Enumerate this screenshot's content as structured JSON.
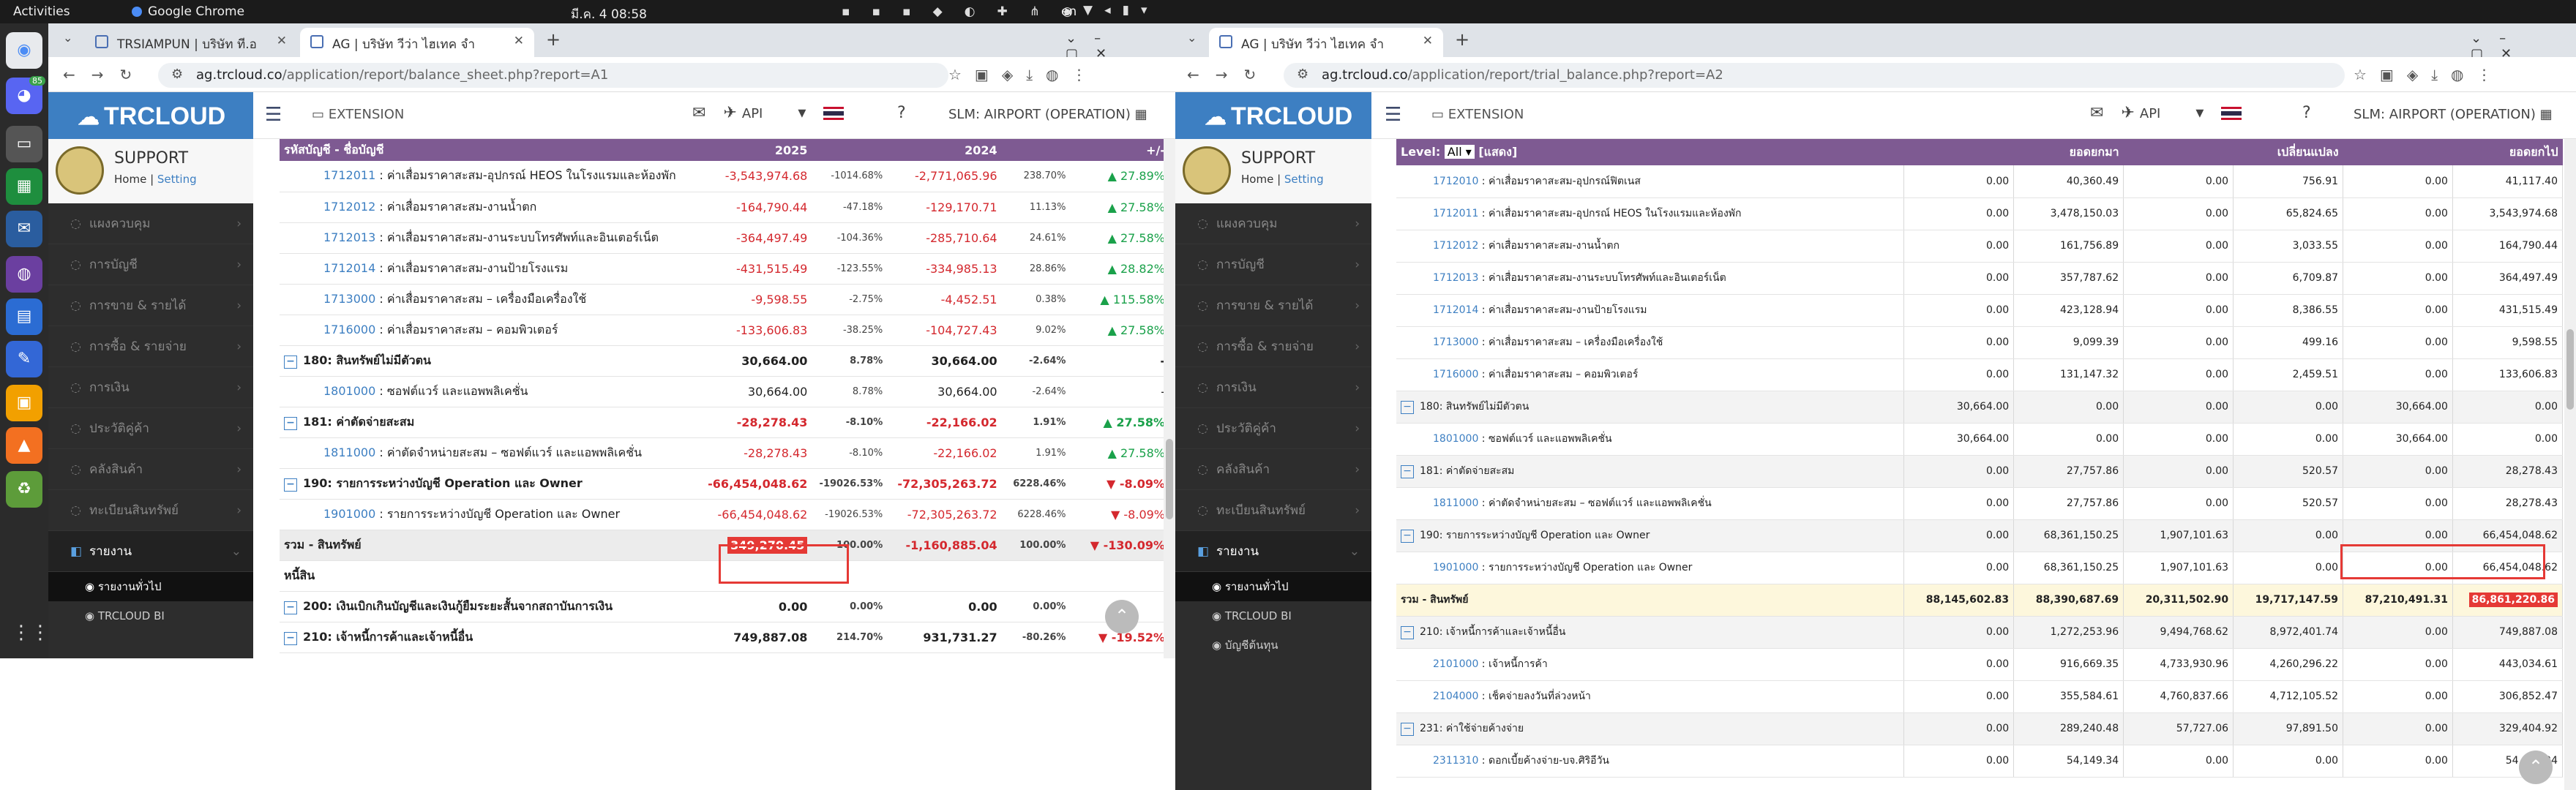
{
  "os": {
    "activities": "Activities",
    "app_name": "Google Chrome",
    "clock": "มี.ค. 4  08:58",
    "lang": "en"
  },
  "dock_badge": "85",
  "left_window": {
    "tabs": [
      {
        "title": "TRSIAMPUN | บริษัท ที.อ"
      },
      {
        "title": "AG | บริษัท วีว่า ไฮเทค จำ"
      }
    ],
    "url_host": "ag.trcloud.co",
    "url_path": "/application/report/balance_sheet.php?report=A1",
    "header": {
      "extension": "EXTENSION",
      "api": "API",
      "slm": "SLM: AIRPORT (OPERATION)"
    },
    "user": {
      "name": "SUPPORT",
      "home": "Home",
      "setting": "Setting"
    },
    "menu": [
      {
        "label": "แผงควบคุม",
        "icon": "dashboard-icon"
      },
      {
        "label": "การบัญชี",
        "icon": "accounting-icon"
      },
      {
        "label": "การขาย & รายได้",
        "icon": "sales-icon"
      },
      {
        "label": "การซื้อ & รายจ่าย",
        "icon": "purchase-icon"
      },
      {
        "label": "การเงิน",
        "icon": "finance-icon"
      },
      {
        "label": "ประวัติคู่ค้า",
        "icon": "contacts-icon"
      },
      {
        "label": "คลังสินค้า",
        "icon": "warehouse-icon"
      },
      {
        "label": "ทะเบียนสินทรัพย์",
        "icon": "asset-icon"
      },
      {
        "label": "รายงาน",
        "icon": "report-icon"
      }
    ],
    "submenu": [
      {
        "label": "รายงานทั่วไป"
      },
      {
        "label": "TRCLOUD BI"
      }
    ],
    "table_head": {
      "name": "รหัสบัญชี - ชื่อบัญชี",
      "y1": "2025",
      "y2": "2024",
      "chg": "+/-"
    },
    "rows": [
      {
        "code": "1712011",
        "name": "ค่าเสื่อมราคาสะสม-อุปกรณ์ HEOS ในโรงแรมและห้องพัก",
        "v1": "-3,543,974.68",
        "p1": "-1014.68%",
        "v2": "-2,771,065.96",
        "p2": "238.70%",
        "c": "27.89%",
        "dir": "up"
      },
      {
        "code": "1712012",
        "name": "ค่าเสื่อมราคาสะสม-งานน้ำตก",
        "v1": "-164,790.44",
        "p1": "-47.18%",
        "v2": "-129,170.71",
        "p2": "11.13%",
        "c": "27.58%",
        "dir": "up"
      },
      {
        "code": "1712013",
        "name": "ค่าเสื่อมราคาสะสม-งานระบบโทรศัพท์และอินเตอร์เน็ต",
        "v1": "-364,497.49",
        "p1": "-104.36%",
        "v2": "-285,710.64",
        "p2": "24.61%",
        "c": "27.58%",
        "dir": "up"
      },
      {
        "code": "1712014",
        "name": "ค่าเสื่อมราคาสะสม-งานป้ายโรงแรม",
        "v1": "-431,515.49",
        "p1": "-123.55%",
        "v2": "-334,985.13",
        "p2": "28.86%",
        "c": "28.82%",
        "dir": "up"
      },
      {
        "code": "1713000",
        "name": "ค่าเสื่อมราคาสะสม – เครื่องมือเครื่องใช้",
        "v1": "-9,598.55",
        "p1": "-2.75%",
        "v2": "-4,452.51",
        "p2": "0.38%",
        "c": "115.58%",
        "dir": "up"
      },
      {
        "code": "1716000",
        "name": "ค่าเสื่อมราคาสะสม – คอมพิวเตอร์",
        "v1": "-133,606.83",
        "p1": "-38.25%",
        "v2": "-104,727.43",
        "p2": "9.02%",
        "c": "27.58%",
        "dir": "up"
      }
    ],
    "g180": {
      "label": "180: สินทรัพย์ไม่มีตัวตน",
      "v1": "30,664.00",
      "p1": "8.78%",
      "v2": "30,664.00",
      "p2": "-2.64%",
      "c": "-"
    },
    "r1801000": {
      "code": "1801000",
      "name": "ซอฟต์แวร์ และแอพพลิเคชั่น",
      "v1": "30,664.00",
      "p1": "8.78%",
      "v2": "30,664.00",
      "p2": "-2.64%",
      "c": "-"
    },
    "g181": {
      "label": "181: ค่าตัดจ่ายสะสม",
      "v1": "-28,278.43",
      "p1": "-8.10%",
      "v2": "-22,166.02",
      "p2": "1.91%",
      "c": "27.58%"
    },
    "r1811000": {
      "code": "1811000",
      "name": "ค่าตัดจำหน่ายสะสม – ซอฟต์แวร์ และแอพพลิเคชั่น",
      "v1": "-28,278.43",
      "p1": "-8.10%",
      "v2": "-22,166.02",
      "p2": "1.91%",
      "c": "27.58%"
    },
    "g190": {
      "label": "190: รายการระหว่างบัญชี Operation และ Owner",
      "v1": "-66,454,048.62",
      "p1": "-19026.53%",
      "v2": "-72,305,263.72",
      "p2": "6228.46%",
      "c": "8.09%"
    },
    "r1901000": {
      "code": "1901000",
      "name": "รายการระหว่างบัญชี Operation และ Owner",
      "v1": "-66,454,048.62",
      "p1": "-19026.53%",
      "v2": "-72,305,263.72",
      "p2": "6228.46%",
      "c": "8.09%"
    },
    "total": {
      "label": "รวม - สินทรัพย์",
      "v1": "349,270.45",
      "p1": "100.00%",
      "v2": "-1,160,885.04",
      "p2": "100.00%",
      "c": "130.09%"
    },
    "liab": "หนี้สิน",
    "g200": {
      "label": "200: เงินเบิกเกินบัญชีและเงินกู้ยืมระยะสั้นจากสถาบันการเงิน",
      "v1": "0.00",
      "p1": "0.00%",
      "v2": "0.00",
      "p2": "0.00%",
      "c": ""
    },
    "g210": {
      "label": "210: เจ้าหนี้การค้าและเจ้าหนี้อื่น",
      "v1": "749,887.08",
      "p1": "214.70%",
      "v2": "931,731.27",
      "p2": "-80.26%",
      "c": "19.52%"
    }
  },
  "right_window": {
    "tab": {
      "title": "AG | บริษัท วีว่า ไฮเทค จำ"
    },
    "url_host": "ag.trcloud.co",
    "url_path": "/application/report/trial_balance.php?report=A2",
    "header": {
      "extension": "EXTENSION",
      "api": "API",
      "slm": "SLM: AIRPORT (OPERATION)"
    },
    "user": {
      "name": "SUPPORT",
      "home": "Home",
      "setting": "Setting"
    },
    "menu": [
      {
        "label": "แผงควบคุม",
        "icon": "dashboard-icon"
      },
      {
        "label": "การบัญชี",
        "icon": "accounting-icon"
      },
      {
        "label": "การขาย & รายได้",
        "icon": "sales-icon"
      },
      {
        "label": "การซื้อ & รายจ่าย",
        "icon": "purchase-icon"
      },
      {
        "label": "การเงิน",
        "icon": "finance-icon"
      },
      {
        "label": "ประวัติคู่ค้า",
        "icon": "contacts-icon"
      },
      {
        "label": "คลังสินค้า",
        "icon": "warehouse-icon"
      },
      {
        "label": "ทะเบียนสินทรัพย์",
        "icon": "asset-icon"
      },
      {
        "label": "รายงาน",
        "icon": "report-icon"
      }
    ],
    "submenu": [
      {
        "label": "รายงานทั่วไป"
      },
      {
        "label": "TRCLOUD BI"
      },
      {
        "label": "บัญชีต้นทุน"
      }
    ],
    "level_label": "Level:",
    "level_value": "All",
    "level_show": "[แสดง]",
    "cols": {
      "open": "ยอดยกมา",
      "move": "เปลี่ยนแปลง",
      "close": "ยอดยกไป"
    },
    "rows": [
      {
        "code": "1712010",
        "name": "ค่าเสื่อมราคาสะสม-อุปกรณ์ฟิตเนส",
        "a": "0.00",
        "b": "40,360.49",
        "c": "0.00",
        "d": "756.91",
        "e": "0.00",
        "f": "41,117.40"
      },
      {
        "code": "1712011",
        "name": "ค่าเสื่อมราคาสะสม-อุปกรณ์ HEOS ในโรงแรมและห้องพัก",
        "a": "0.00",
        "b": "3,478,150.03",
        "c": "0.00",
        "d": "65,824.65",
        "e": "0.00",
        "f": "3,543,974.68"
      },
      {
        "code": "1712012",
        "name": "ค่าเสื่อมราคาสะสม-งานน้ำตก",
        "a": "0.00",
        "b": "161,756.89",
        "c": "0.00",
        "d": "3,033.55",
        "e": "0.00",
        "f": "164,790.44"
      },
      {
        "code": "1712013",
        "name": "ค่าเสื่อมราคาสะสม-งานระบบโทรศัพท์และอินเตอร์เน็ต",
        "a": "0.00",
        "b": "357,787.62",
        "c": "0.00",
        "d": "6,709.87",
        "e": "0.00",
        "f": "364,497.49"
      },
      {
        "code": "1712014",
        "name": "ค่าเสื่อมราคาสะสม-งานป้ายโรงแรม",
        "a": "0.00",
        "b": "423,128.94",
        "c": "0.00",
        "d": "8,386.55",
        "e": "0.00",
        "f": "431,515.49"
      },
      {
        "code": "1713000",
        "name": "ค่าเสื่อมราคาสะสม – เครื่องมือเครื่องใช้",
        "a": "0.00",
        "b": "9,099.39",
        "c": "0.00",
        "d": "499.16",
        "e": "0.00",
        "f": "9,598.55"
      },
      {
        "code": "1716000",
        "name": "ค่าเสื่อมราคาสะสม – คอมพิวเตอร์",
        "a": "0.00",
        "b": "131,147.32",
        "c": "0.00",
        "d": "2,459.51",
        "e": "0.00",
        "f": "133,606.83"
      }
    ],
    "g180": {
      "label": "180: สินทรัพย์ไม่มีตัวตน",
      "a": "30,664.00",
      "b": "0.00",
      "c": "0.00",
      "d": "0.00",
      "e": "30,664.00",
      "f": "0.00"
    },
    "r1801000": {
      "code": "1801000",
      "name": "ซอฟต์แวร์ และแอพพลิเคชั่น",
      "a": "30,664.00",
      "b": "0.00",
      "c": "0.00",
      "d": "0.00",
      "e": "30,664.00",
      "f": "0.00"
    },
    "g181": {
      "label": "181: ค่าตัดจ่ายสะสม",
      "a": "0.00",
      "b": "27,757.86",
      "c": "0.00",
      "d": "520.57",
      "e": "0.00",
      "f": "28,278.43"
    },
    "r1811000": {
      "code": "1811000",
      "name": "ค่าตัดจำหน่ายสะสม – ซอฟต์แวร์ และแอพพลิเคชั่น",
      "a": "0.00",
      "b": "27,757.86",
      "c": "0.00",
      "d": "520.57",
      "e": "0.00",
      "f": "28,278.43"
    },
    "g190": {
      "label": "190: รายการระหว่างบัญชี Operation และ Owner",
      "a": "0.00",
      "b": "68,361,150.25",
      "c": "1,907,101.63",
      "d": "0.00",
      "e": "0.00",
      "f": "66,454,048.62"
    },
    "r1901000": {
      "code": "1901000",
      "name": "รายการระหว่างบัญชี Operation และ Owner",
      "a": "0.00",
      "b": "68,361,150.25",
      "c": "1,907,101.63",
      "d": "0.00",
      "e": "0.00",
      "f": "66,454,048.62"
    },
    "total": {
      "label": "รวม - สินทรัพย์",
      "a": "88,145,602.83",
      "b": "88,390,687.69",
      "c": "20,311,502.90",
      "d": "19,717,147.59",
      "e": "87,210,491.31",
      "f": "86,861,220.86"
    },
    "g210": {
      "label": "210: เจ้าหนี้การค้าและเจ้าหนี้อื่น",
      "a": "0.00",
      "b": "1,272,253.96",
      "c": "9,494,768.62",
      "d": "8,972,401.74",
      "e": "0.00",
      "f": "749,887.08"
    },
    "r2101000": {
      "code": "2101000",
      "name": "เจ้าหนี้การค้า",
      "a": "0.00",
      "b": "916,669.35",
      "c": "4,733,930.96",
      "d": "4,260,296.22",
      "e": "0.00",
      "f": "443,034.61"
    },
    "r2104000": {
      "code": "2104000",
      "name": "เช็คจ่ายลงวันที่ล่วงหน้า",
      "a": "0.00",
      "b": "355,584.61",
      "c": "4,760,837.66",
      "d": "4,712,105.52",
      "e": "0.00",
      "f": "306,852.47"
    },
    "g231": {
      "label": "231: ค่าใช้จ่ายค้างจ่าย",
      "a": "0.00",
      "b": "289,240.48",
      "c": "57,727.06",
      "d": "97,891.50",
      "e": "0.00",
      "f": "329,404.92"
    },
    "r2311310": {
      "code": "2311310",
      "name": "ดอกเบี้ยค้างจ่าย-บจ.ศิริอีวัน",
      "a": "0.00",
      "b": "54,149.34",
      "c": "0.00",
      "d": "0.00",
      "e": "0.00",
      "f": "54,149.34"
    }
  },
  "colors": {
    "header_purple": "#7e5a92",
    "logo_blue": "#3d7fc2",
    "negative": "#d4282e",
    "positive": "#1aa14a"
  }
}
